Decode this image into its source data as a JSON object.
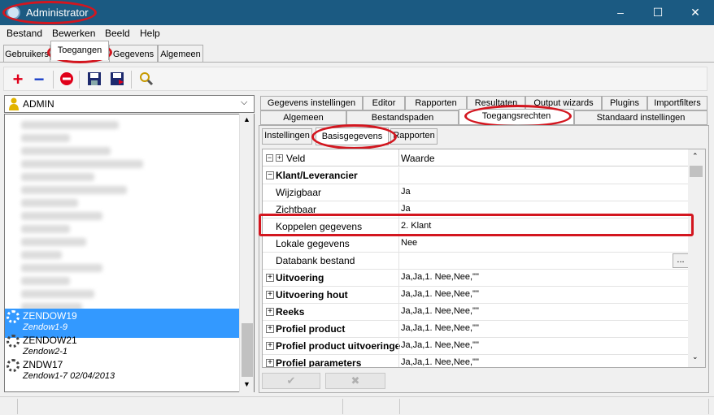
{
  "window": {
    "title": "Administrator",
    "minimize": "–",
    "maximize": "☐",
    "close": "✕"
  },
  "menu": [
    "Bestand",
    "Bewerken",
    "Beeld",
    "Help"
  ],
  "top_tabs": [
    "Gebruikers",
    "Toegangen",
    "Gegevens",
    "Algemeen"
  ],
  "toolbar": {
    "add": "+",
    "remove": "−"
  },
  "left": {
    "combo_value": "ADMIN",
    "users": [
      {
        "name": "ZENDOW19",
        "sub": "Zendow1-9"
      },
      {
        "name": "ZENDOW21",
        "sub": "Zendow2-1"
      },
      {
        "name": "ZNDW17",
        "sub": "Zendow1-7 02/04/2013"
      }
    ]
  },
  "right_tabs_row1": [
    "Gegevens instellingen",
    "Editor",
    "Rapporten",
    "Resultaten",
    "Output wizards",
    "Plugins",
    "Importfilters"
  ],
  "right_tabs_row2": [
    "Algemeen",
    "Bestandspaden",
    "Toegangsrechten",
    "Standaard instellingen"
  ],
  "sub_tabs": [
    "Instellingen",
    "Basisgegevens",
    "Rapporten"
  ],
  "grid": {
    "col_field": "Veld",
    "col_value": "Waarde",
    "rows": [
      {
        "label": "Klant/Leverancier",
        "value": "",
        "bold": true,
        "expander": "−"
      },
      {
        "label": "Wijzigbaar",
        "value": "Ja"
      },
      {
        "label": "Zichtbaar",
        "value": "Ja"
      },
      {
        "label": "Koppelen gegevens",
        "value": "2. Klant"
      },
      {
        "label": "Lokale gegevens",
        "value": "Nee"
      },
      {
        "label": "Databank bestand",
        "value": "",
        "button": "..."
      },
      {
        "label": "Uitvoering",
        "value": "Ja,Ja,1. Nee,Nee,\"\"",
        "bold": true,
        "expander": "+"
      },
      {
        "label": "Uitvoering hout",
        "value": "Ja,Ja,1. Nee,Nee,\"\"",
        "bold": true,
        "expander": "+"
      },
      {
        "label": "Reeks",
        "value": "Ja,Ja,1. Nee,Nee,\"\"",
        "bold": true,
        "expander": "+"
      },
      {
        "label": "Profiel product",
        "value": "Ja,Ja,1. Nee,Nee,\"\"",
        "bold": true,
        "expander": "+"
      },
      {
        "label": "Profiel product uitvoeringe",
        "value": "Ja,Ja,1. Nee,Nee,\"\"",
        "bold": true,
        "expander": "+"
      },
      {
        "label": "Profiel parameters",
        "value": "Ja,Ja,1. Nee,Nee,\"\"",
        "bold": true,
        "expander": "+"
      }
    ]
  },
  "buttons": {
    "ok": "✔",
    "cancel": "✖"
  },
  "colors": {
    "titlebar": "#1b5a82",
    "selection": "#3399ff",
    "annotation": "#d3161f"
  }
}
